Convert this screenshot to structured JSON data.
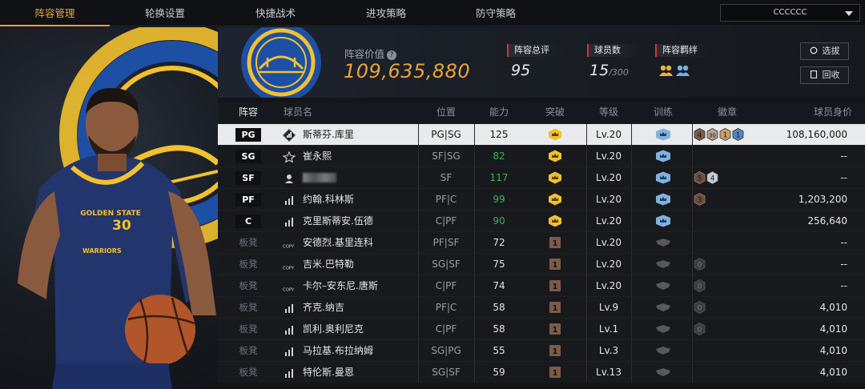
{
  "nav": {
    "tabs": [
      "阵容管理",
      "轮换设置",
      "快捷战术",
      "进攻策略",
      "防守策略"
    ],
    "active_tab": 0,
    "team_select": "CCCCCC"
  },
  "header": {
    "value_label": "阵容价值",
    "value": "109,635,880",
    "rating_label": "阵容总评",
    "rating": "95",
    "players_label": "球员数",
    "players_count": "15",
    "players_max": "/300",
    "bond_label": "阵容羁绊",
    "draft_button": "选拔",
    "recycle_button": "回收"
  },
  "table": {
    "headers": {
      "lineup": "阵容",
      "name": "球员名",
      "position": "位置",
      "ability": "能力",
      "breakthrough": "突破",
      "level": "等级",
      "training": "训练",
      "badges": "徽章",
      "worth": "球员身价"
    },
    "rows": [
      {
        "slot": "PG",
        "name": "斯蒂芬.库里",
        "icon": "gold-stats-icon",
        "position": "PG|SG",
        "ability": "125",
        "ability_color": "white",
        "break": "crown",
        "level": "Lv.20",
        "train": "crown",
        "badges": [
          "4",
          "30",
          "1",
          "1"
        ],
        "worth": "108,160,000",
        "selected": true
      },
      {
        "slot": "SG",
        "name": "崔永熙",
        "icon": "star-icon",
        "position": "SF|SG",
        "ability": "82",
        "ability_color": "green",
        "break": "crown",
        "level": "Lv.20",
        "train": "crown",
        "badges": [],
        "worth": "--"
      },
      {
        "slot": "SF",
        "name": "",
        "icon": "person-icon",
        "blurred": true,
        "position": "SF",
        "ability": "117",
        "ability_color": "green",
        "break": "crown",
        "level": "Lv.20",
        "train": "crown",
        "badges": [
          "5",
          "4"
        ],
        "worth": "--"
      },
      {
        "slot": "PF",
        "name": "约翰.科林斯",
        "icon": "stats-icon",
        "position": "PF|C",
        "ability": "99",
        "ability_color": "green",
        "break": "crown",
        "level": "Lv.20",
        "train": "crown",
        "badges": [
          "3"
        ],
        "worth": "1,203,200"
      },
      {
        "slot": "C",
        "name": "克里斯蒂安.伍德",
        "icon": "stats-icon",
        "position": "C|PF",
        "ability": "90",
        "ability_color": "green",
        "break": "crown",
        "level": "Lv.20",
        "train": "crown",
        "badges": [],
        "worth": "256,640"
      },
      {
        "slot": "板凳",
        "name": "安德烈.基里连科",
        "icon": "copy-icon",
        "position": "PF|SF",
        "ability": "72",
        "ability_color": "white",
        "break": "1",
        "level": "Lv.20",
        "train": "gray",
        "badges": [],
        "worth": "--"
      },
      {
        "slot": "板凳",
        "name": "吉米.巴特勒",
        "icon": "copy-icon",
        "position": "SG|SF",
        "ability": "75",
        "ability_color": "white",
        "break": "1",
        "level": "Lv.20",
        "train": "gray",
        "badges": [
          "0"
        ],
        "worth": "--"
      },
      {
        "slot": "板凳",
        "name": "卡尔–安东尼.唐斯",
        "icon": "copy-icon",
        "position": "C|PF",
        "ability": "74",
        "ability_color": "white",
        "break": "1",
        "level": "Lv.20",
        "train": "gray",
        "badges": [
          "0"
        ],
        "worth": "--"
      },
      {
        "slot": "板凳",
        "name": "齐克.纳吉",
        "icon": "stats-icon",
        "position": "PF|C",
        "ability": "58",
        "ability_color": "white",
        "break": "1",
        "level": "Lv.9",
        "train": "gray",
        "badges": [
          "0"
        ],
        "worth": "4,010"
      },
      {
        "slot": "板凳",
        "name": "凯利.奥利尼克",
        "icon": "stats-icon",
        "position": "C|PF",
        "ability": "58",
        "ability_color": "white",
        "break": "1",
        "level": "Lv.1",
        "train": "gray",
        "badges": [
          "0"
        ],
        "worth": "4,010"
      },
      {
        "slot": "板凳",
        "name": "马拉基.布拉纳姆",
        "icon": "stats-icon",
        "position": "SG|PG",
        "ability": "55",
        "ability_color": "white",
        "break": "1",
        "level": "Lv.3",
        "train": "gray",
        "badges": [],
        "worth": "4,010"
      },
      {
        "slot": "板凳",
        "name": "特伦斯.曼恩",
        "icon": "stats-icon",
        "position": "SG|SF",
        "ability": "59",
        "ability_color": "white",
        "break": "1",
        "level": "Lv.13",
        "train": "gray",
        "badges": [],
        "worth": "4,010"
      }
    ]
  },
  "player_art": {
    "team_name": "GOLDEN STATE",
    "jersey_number": "30",
    "team_word": "WARRIORS"
  },
  "colors": {
    "accent": "#e8a33c",
    "stat_red": "#d8342c",
    "green": "#3fb34f",
    "warriors_blue": "#1d4fa5",
    "warriors_gold": "#f2c12e"
  }
}
